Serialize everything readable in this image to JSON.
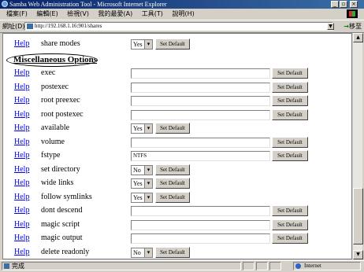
{
  "window": {
    "title": "Samba Web Administration Tool - Microsoft Internet Explorer"
  },
  "menu": [
    "檔案(F)",
    "編輯(E)",
    "檢視(V)",
    "我的最愛(A)",
    "工具(T)",
    "說明(H)"
  ],
  "address": {
    "label": "網址(D)",
    "url": "http://192.168.1.16:901/shares",
    "go_label": "移至"
  },
  "top_row": {
    "help": "Help",
    "name": "share modes",
    "select": "Yes",
    "button": "Set Default"
  },
  "section_title": "Miscellaneous Options",
  "params": [
    {
      "help": "Help",
      "name": "exec",
      "value": "",
      "button": "Set Default"
    },
    {
      "help": "Help",
      "name": "postexec",
      "value": "",
      "button": "Set Default"
    },
    {
      "help": "Help",
      "name": "root preexec",
      "value": "",
      "button": "Set Default"
    },
    {
      "help": "Help",
      "name": "root postexec",
      "value": "",
      "button": "Set Default"
    },
    {
      "help": "Help",
      "name": "available",
      "select": "Yes",
      "button": "Set Default"
    },
    {
      "help": "Help",
      "name": "volume",
      "value": "",
      "button": "Set Default"
    },
    {
      "help": "Help",
      "name": "fstype",
      "value": "NTFS",
      "button": "Set Default"
    },
    {
      "help": "Help",
      "name": "set directory",
      "select": "No",
      "button": "Set Default"
    },
    {
      "help": "Help",
      "name": "wide links",
      "select": "Yes",
      "button": "Set Default"
    },
    {
      "help": "Help",
      "name": "follow symlinks",
      "select": "Yes",
      "button": "Set Default"
    },
    {
      "help": "Help",
      "name": "dont descend",
      "value": "",
      "button": "Set Default"
    },
    {
      "help": "Help",
      "name": "magic script",
      "value": "",
      "button": "Set Default"
    },
    {
      "help": "Help",
      "name": "magic output",
      "value": "",
      "button": "Set Default"
    },
    {
      "help": "Help",
      "name": "delete readonly",
      "select": "No",
      "button": "Set Default"
    }
  ],
  "status": {
    "text": "完成",
    "zone": "Internet"
  }
}
